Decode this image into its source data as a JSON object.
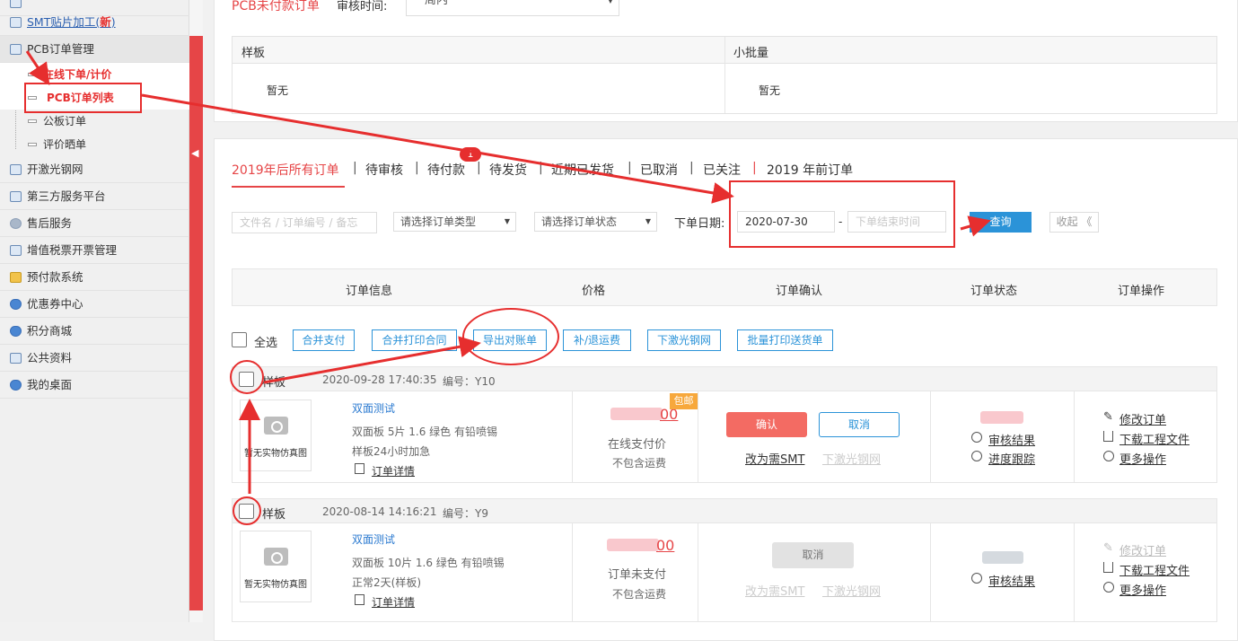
{
  "sidebar": {
    "items": [
      {
        "label": "",
        "icon": "doc-icon"
      },
      {
        "label": "SMT贴片加工(",
        "badge": "新",
        "suffix": ")",
        "icon": "doc-icon"
      },
      {
        "label": "PCB订单管理",
        "icon": "doc-icon"
      },
      {
        "label": "开激光钢网",
        "icon": "doc-icon"
      },
      {
        "label": "第三方服务平台",
        "icon": "image-icon"
      },
      {
        "label": "售后服务",
        "icon": "user-icon"
      },
      {
        "label": "增值税票开票管理",
        "icon": "doc-icon"
      },
      {
        "label": "预付款系统",
        "icon": "cup-icon"
      },
      {
        "label": "优惠券中心",
        "icon": "shield-icon"
      },
      {
        "label": "积分商城",
        "icon": "shield-icon"
      },
      {
        "label": "公共资料",
        "icon": "image-icon"
      },
      {
        "label": "我的桌面",
        "icon": "shield-icon"
      }
    ],
    "subitems": [
      {
        "label": "在线下单/计价"
      },
      {
        "label": "PCB订单列表"
      },
      {
        "label": "公板订单"
      },
      {
        "label": "评价晒单"
      }
    ]
  },
  "top_panel": {
    "title": "PCB未付款订单",
    "audit_label": "审核时间:",
    "audit_value": "一周内",
    "col1": "样板",
    "col2": "小批量",
    "empty1": "暂无",
    "empty2": "暂无"
  },
  "tabs": [
    {
      "label": "2019年后所有订单",
      "active": true
    },
    {
      "label": "待审核"
    },
    {
      "label": "待付款",
      "badge": "1"
    },
    {
      "label": "待发货"
    },
    {
      "label": "近期已发货"
    },
    {
      "label": "已取消"
    },
    {
      "label": "已关注"
    },
    {
      "label": "2019 年前订单"
    }
  ],
  "filters": {
    "search_placeholder": "文件名 / 订单编号 / 备忘",
    "type_placeholder": "请选择订单类型",
    "status_placeholder": "请选择订单状态",
    "date_label": "下单日期:",
    "date_start": "2020-07-30",
    "date_sep": "-",
    "date_end_placeholder": "下单结束时间",
    "query": "查询",
    "collapse": "收起 《"
  },
  "table_header": [
    "订单信息",
    "价格",
    "订单确认",
    "订单状态",
    "订单操作"
  ],
  "bulk": {
    "select_all": "全选",
    "buttons": [
      "合并支付",
      "合并打印合同",
      "导出对账单",
      "补/退运费",
      "下激光钢网",
      "批量打印送货单"
    ]
  },
  "orders": [
    {
      "type": "样板",
      "time": "2020-09-28 17:40:35",
      "no": "编号：Y10",
      "photo": "暂无实物仿真图",
      "name": "双面测试",
      "specs": "双面板   5片   1.6   绿色   有铅喷锡",
      "delivery": "样板24小时加急",
      "detail": "订单详情",
      "price_suffix": "00",
      "price_badge": "包邮",
      "price_label": "在线支付价",
      "shipping": "不包含运费",
      "confirm": "确认",
      "cancel": "取消",
      "to_smt": "改为需SMT",
      "stencil": "下激光钢网",
      "audit": "审核结果",
      "track": "进度跟踪",
      "op1": "修改订单",
      "op2": "下载工程文件",
      "op3": "更多操作"
    },
    {
      "type": "样板",
      "time": "2020-08-14 14:16:21",
      "no": "编号：Y9",
      "photo": "暂无实物仿真图",
      "name": "双面测试",
      "specs": "双面板   10片   1.6   绿色   有铅喷锡",
      "delivery": "正常2天(样板)",
      "detail": "订单详情",
      "price_suffix": "00",
      "price_label": "订单未支付",
      "shipping": "不包含运费",
      "cancel": "取消",
      "to_smt": "改为需SMT",
      "stencil": "下激光钢网",
      "audit": "审核结果",
      "op1": "修改订单",
      "op2": "下载工程文件",
      "op3": "更多操作"
    }
  ],
  "colors": {
    "accent": "#e64547",
    "blue": "#2b93d8",
    "annotation": "#e62e2e"
  }
}
